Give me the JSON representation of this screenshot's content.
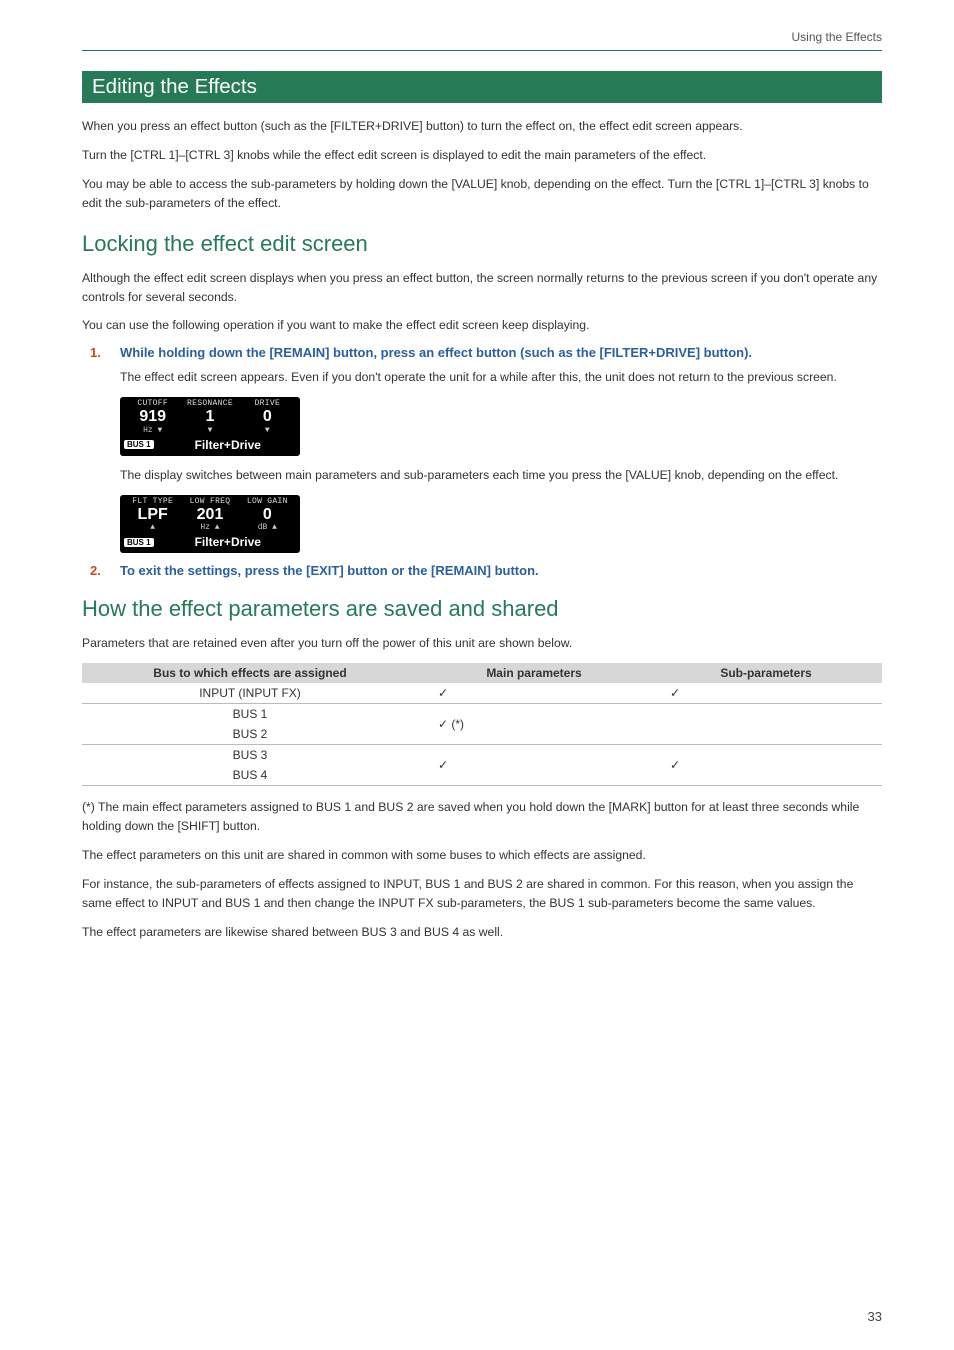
{
  "running_head": "Using the Effects",
  "section_title": "Editing the Effects",
  "intro": [
    "When you press an effect button (such as the [FILTER+DRIVE] button) to turn the effect on, the effect edit screen appears.",
    "Turn the [CTRL 1]–[CTRL 3] knobs while the effect edit screen is displayed to edit the main parameters of the effect.",
    "You may be able to access the sub-parameters by holding down the [VALUE] knob, depending on the effect. Turn the [CTRL 1]–[CTRL 3] knobs to edit the sub-parameters of the effect."
  ],
  "h2_lock": "Locking the effect edit screen",
  "lock_intro": [
    "Although the effect edit screen displays when you press an effect button, the screen normally returns to the previous screen if you don't operate any controls for several seconds.",
    "You can use the following operation if you want to make the effect edit screen keep displaying."
  ],
  "step1": {
    "num": "1.",
    "text": "While holding down the [REMAIN] button, press an effect button (such as the [FILTER+DRIVE] button)."
  },
  "step1_after": "The effect edit screen appears. Even if you don't operate the unit for a while after this, the unit does not return to the previous screen.",
  "lcd1": {
    "labels": [
      "CUTOFF",
      "RESONANCE",
      "DRIVE"
    ],
    "values": [
      "919",
      "1",
      "0"
    ],
    "sub": [
      "Hz ▼",
      "▼",
      "▼"
    ],
    "bus": "BUS 1",
    "title": "Filter+Drive"
  },
  "lcd_between": "The display switches between main parameters and sub-parameters each time you press the [VALUE] knob, depending on the effect.",
  "lcd2": {
    "labels": [
      "FLT TYPE",
      "LOW FREQ",
      "LOW GAIN"
    ],
    "values": [
      "LPF",
      "201",
      "0"
    ],
    "sub": [
      "▲",
      "Hz ▲",
      "dB ▲"
    ],
    "bus": "BUS 1",
    "title": "Filter+Drive"
  },
  "step2": {
    "num": "2.",
    "text": "To exit the settings, press the [EXIT] button or the [REMAIN] button."
  },
  "h2_save": "How the effect parameters are saved and shared",
  "save_intro": "Parameters that are retained even after you turn off the power of this unit are shown below.",
  "table": {
    "headers": [
      "Bus to which effects are assigned",
      "Main parameters",
      "Sub-parameters"
    ],
    "rows": [
      {
        "bus": "INPUT (INPUT FX)",
        "main": "✓",
        "sub": "✓"
      },
      {
        "bus": "BUS 1",
        "main": "✓ (*)",
        "sub": ""
      },
      {
        "bus": "BUS 2",
        "main": "",
        "sub": ""
      },
      {
        "bus": "BUS 3",
        "main": "✓",
        "sub": "✓"
      },
      {
        "bus": "BUS 4",
        "main": "",
        "sub": ""
      }
    ]
  },
  "footnotes": [
    "(*) The main effect parameters assigned to BUS 1 and BUS 2 are saved when you hold down the [MARK] button for at least three seconds while holding down the [SHIFT] button.",
    "The effect parameters on this unit are shared in common with some buses to which effects are assigned.",
    "For instance, the sub-parameters of effects assigned to INPUT, BUS 1 and BUS 2 are shared in common. For this reason, when you assign the same effect to INPUT and BUS 1 and then change the INPUT FX sub-parameters, the BUS 1 sub-parameters become the same values.",
    "The effect parameters are likewise shared between BUS 3 and BUS 4 as well."
  ],
  "page_number": "33"
}
